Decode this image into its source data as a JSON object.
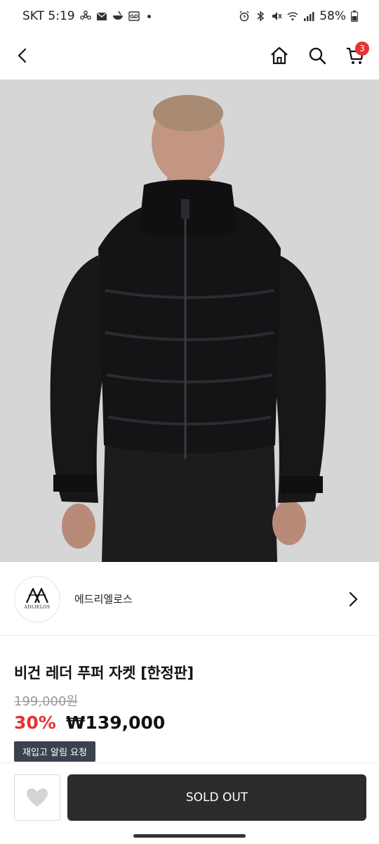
{
  "status_bar": {
    "carrier_time": "SKT 5:19",
    "battery": "58%"
  },
  "header": {
    "cart_count": "3",
    "icons": [
      "back-arrow-icon",
      "home-icon",
      "search-icon",
      "cart-icon"
    ]
  },
  "brand": {
    "logo_text": "ADLIELOS",
    "name": "에드리엘로스"
  },
  "product": {
    "title": "비건 레더 푸퍼 자켓 [한정판]",
    "original_price": "199,000원",
    "discount": "30%",
    "sale_price": "₩139,000",
    "restock_label": "재입고 알림 요청"
  },
  "actions": {
    "sold_out_label": "SOLD OUT"
  },
  "colors": {
    "accent_red": "#e8312f",
    "dark_button": "#2b2b2b",
    "restock_bg": "#3c4150"
  }
}
